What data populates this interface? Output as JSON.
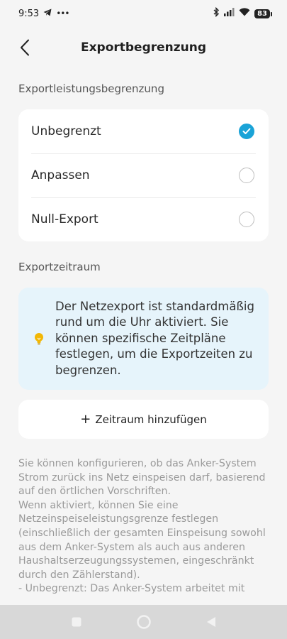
{
  "status_bar": {
    "time": "9:53",
    "battery": "83",
    "icons": [
      "telegram-icon",
      "more-dots-icon",
      "bluetooth-icon",
      "signal-icon",
      "wifi-icon",
      "battery-icon"
    ]
  },
  "header": {
    "title": "Exportbegrenzung",
    "back_icon": "chevron-left-icon"
  },
  "export_limit": {
    "section_label": "Exportleistungsbegrenzung",
    "options": [
      {
        "label": "Unbegrenzt",
        "selected": true
      },
      {
        "label": "Anpassen",
        "selected": false
      },
      {
        "label": "Null-Export",
        "selected": false
      }
    ]
  },
  "export_period": {
    "section_label": "Exportzeitraum",
    "info_icon": "lightbulb-icon",
    "info_text": "Der Netzexport ist standardmäßig rund um die Uhr aktiviert. Sie können spezifische Zeitpläne festlegen, um die Exportzeiten zu begrenzen.",
    "add_button_label": "Zeitraum hinzufügen",
    "add_button_icon": "+"
  },
  "description": "Sie können konfigurieren, ob das Anker-System Strom zurück ins Netz einspeisen darf, basierend auf den örtlichen Vorschriften.\nWenn aktiviert, können Sie eine Netzeinspeiseleistungsgrenze festlegen (einschließlich der gesamten Einspeisung sowohl aus dem Anker-System als auch aus anderen Haushaltserzeugungssystemen, eingeschränkt durch den Zählerstand).\n- Unbegrenzt: Das Anker-System arbeitet mit",
  "colors": {
    "accent": "#1aa3d7",
    "info_bg": "#e6f4fb",
    "bulb": "#f2b705"
  }
}
